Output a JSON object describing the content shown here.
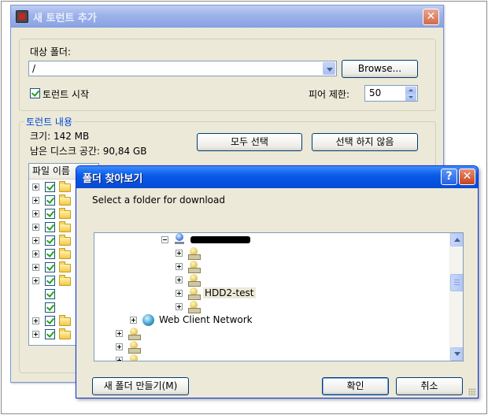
{
  "main_window": {
    "title": "새 토런트 추가",
    "close_glyph": "✕",
    "target_folder": {
      "label": "대상 폴더:",
      "value": "/",
      "browse_button": "Browse..."
    },
    "start_torrent": {
      "label": "토런트 시작",
      "checked": true
    },
    "peer_limit": {
      "label": "피어 제한:",
      "value": "50"
    },
    "contents": {
      "legend": "토런트 내용",
      "size": "크기: 142 MB",
      "free_space": "남은 디스크 공간: 90,84 GB",
      "select_all_button": "모두 선택",
      "deselect_all_button": "선택 하지 않음",
      "file_list_header": "파일 이름"
    }
  },
  "browse_dialog": {
    "title": "폴더 찾아보기",
    "help_glyph": "?",
    "close_glyph": "✕",
    "prompt": "Select a folder for download",
    "tree": {
      "selected_folder": "HDD2-test",
      "network_node": "Web Client Network"
    },
    "new_folder_button": "새 폴더 만들기(M)",
    "ok_button": "확인",
    "cancel_button": "취소"
  },
  "icons": {
    "app": "app-icon",
    "expand": "plus-box-icon",
    "collapse": "minus-box-icon",
    "folder": "folder-icon",
    "drive": "drive-icon",
    "network": "network-globe-icon",
    "computer": "computer-icon"
  },
  "colors": {
    "window_face": "#ece9d8",
    "active_title": "#0453e0",
    "inactive_title": "#9db2ea",
    "group_legend": "#0046d5",
    "check_mark": "#21a121"
  }
}
